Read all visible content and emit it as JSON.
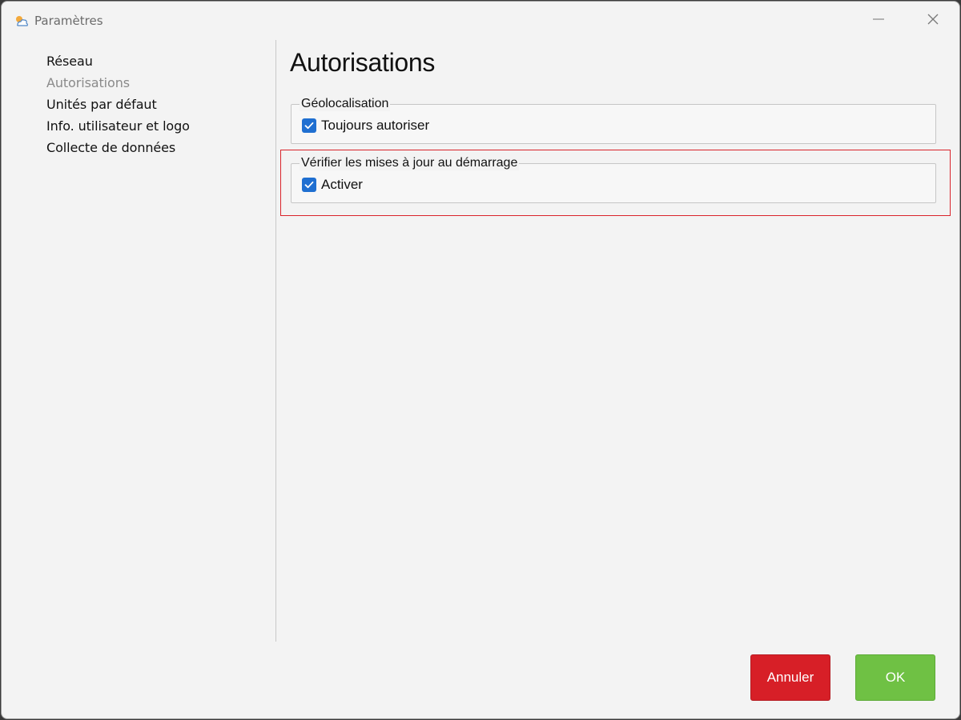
{
  "window": {
    "title": "Paramètres",
    "icon": "weather-app-icon",
    "controls": {
      "minimize_icon": "minimize-icon",
      "close_icon": "close-icon"
    }
  },
  "sidebar": {
    "items": [
      {
        "label": "Réseau",
        "state": "normal"
      },
      {
        "label": "Autorisations",
        "state": "selected"
      },
      {
        "label": "Unités par défaut",
        "state": "normal"
      },
      {
        "label": "Info. utilisateur et logo",
        "state": "normal"
      },
      {
        "label": "Collecte de données",
        "state": "normal"
      }
    ]
  },
  "main": {
    "title": "Autorisations",
    "groups": [
      {
        "legend": "Géolocalisation",
        "checkbox": {
          "label": "Toujours autoriser",
          "checked": true
        }
      },
      {
        "legend": "Vérifier les mises à jour au démarrage",
        "checkbox": {
          "label": "Activer",
          "checked": true
        }
      }
    ]
  },
  "footer": {
    "cancel_label": "Annuler",
    "ok_label": "OK"
  },
  "colors": {
    "checkbox": "#1f6fd1",
    "cancel": "#d71f27",
    "ok": "#6fc144",
    "highlight": "#d9232a"
  }
}
